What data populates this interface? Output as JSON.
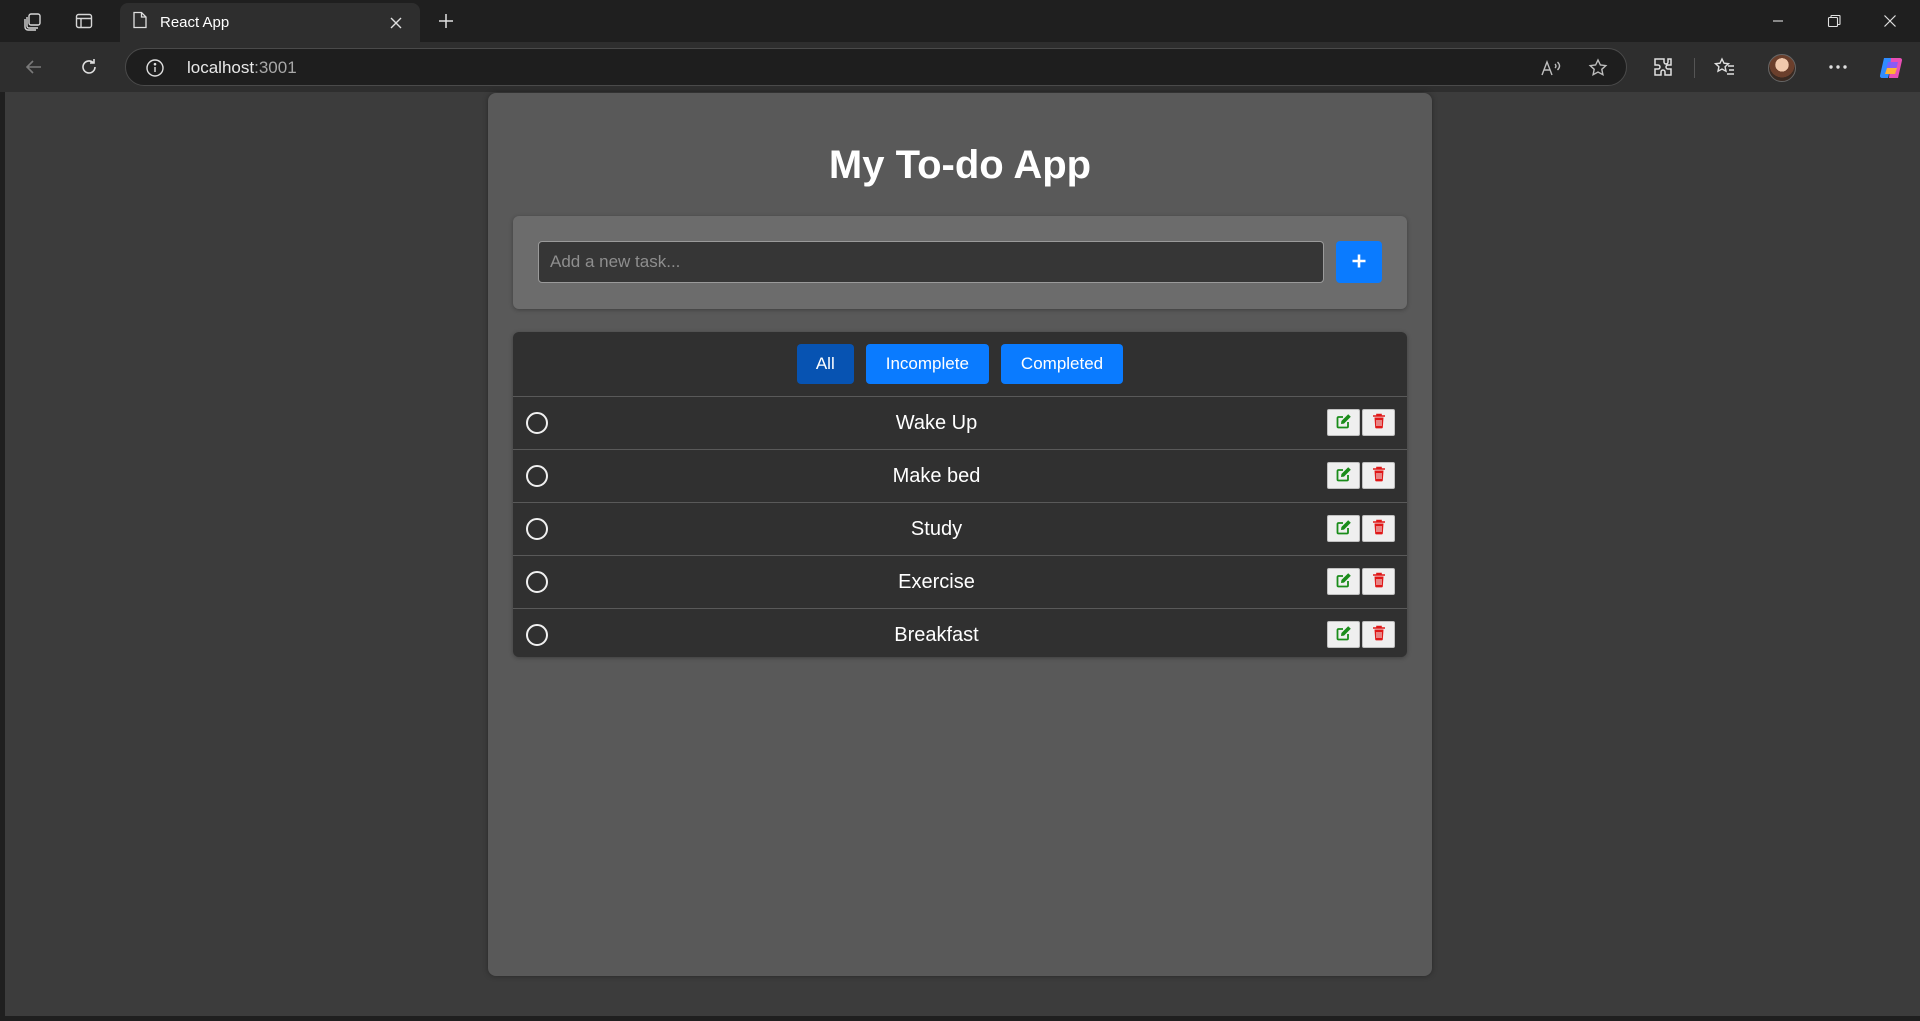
{
  "browser": {
    "tab_title": "React App",
    "url_host": "localhost",
    "url_port": ":3001"
  },
  "app": {
    "title": "My To-do App",
    "input_placeholder": "Add a new task...",
    "add_button_symbol": "+",
    "filters": [
      {
        "label": "All",
        "active": true
      },
      {
        "label": "Incomplete",
        "active": false
      },
      {
        "label": "Completed",
        "active": false
      }
    ],
    "tasks": [
      {
        "text": "Wake Up",
        "completed": false
      },
      {
        "text": "Make bed",
        "completed": false
      },
      {
        "text": "Study",
        "completed": false
      },
      {
        "text": "Exercise",
        "completed": false
      },
      {
        "text": "Breakfast",
        "completed": false
      }
    ]
  },
  "colors": {
    "accent_blue": "#0a7bff",
    "active_filter_blue": "#0753b2",
    "edit_green": "#1a8c1a",
    "delete_red": "#e01818"
  },
  "icons": {
    "tab": "page-icon",
    "edit": "edit-icon",
    "delete": "trash-icon",
    "task_status": "circle-icon"
  }
}
